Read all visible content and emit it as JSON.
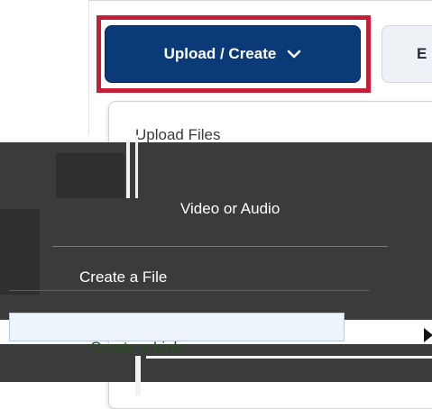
{
  "toolbar": {
    "upload_create_label": "Upload / Create",
    "next_button_label": "E"
  },
  "menu": {
    "items": [
      {
        "label": "Upload Files"
      },
      {
        "label": "Video or Audio"
      },
      {
        "label": "Create a File"
      },
      {
        "label": "Create a Link"
      }
    ]
  },
  "colors": {
    "primary_button": "#0a3a78",
    "highlight_border": "#c41f36"
  }
}
